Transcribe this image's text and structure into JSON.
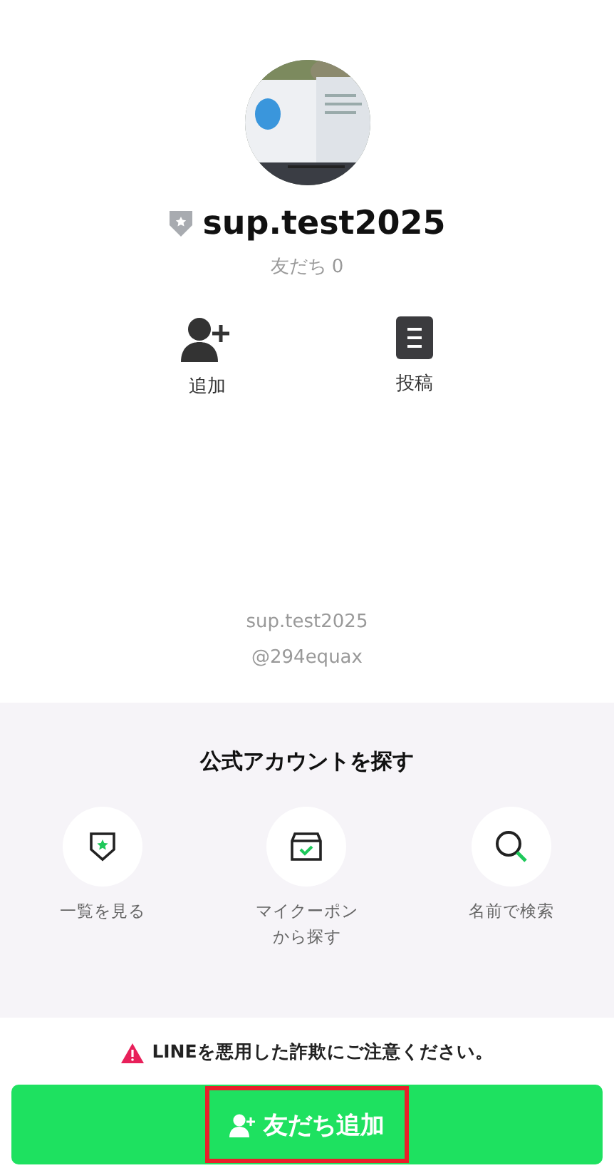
{
  "profile": {
    "kind": "picture",
    "name": "sup.test2025",
    "friends": "友だち 0"
  },
  "actions": [
    {
      "kind": "add",
      "label": "追加"
    },
    {
      "kind": "post",
      "label": "投稿"
    }
  ],
  "ids": {
    "name": "sup.test2025",
    "line_id": "@294equax"
  },
  "explore": {
    "title": "公式アカウントを探す",
    "items": [
      {
        "kind": "list",
        "label": "一覧を見る"
      },
      {
        "kind": "coupon",
        "label": "マイクーポンから探す"
      },
      {
        "kind": "search",
        "label": "名前で検索"
      }
    ]
  },
  "warning": "LINEを悪用した詐欺にご注意ください。",
  "add_button": {
    "label": "友だち追加",
    "highlighted": true
  }
}
